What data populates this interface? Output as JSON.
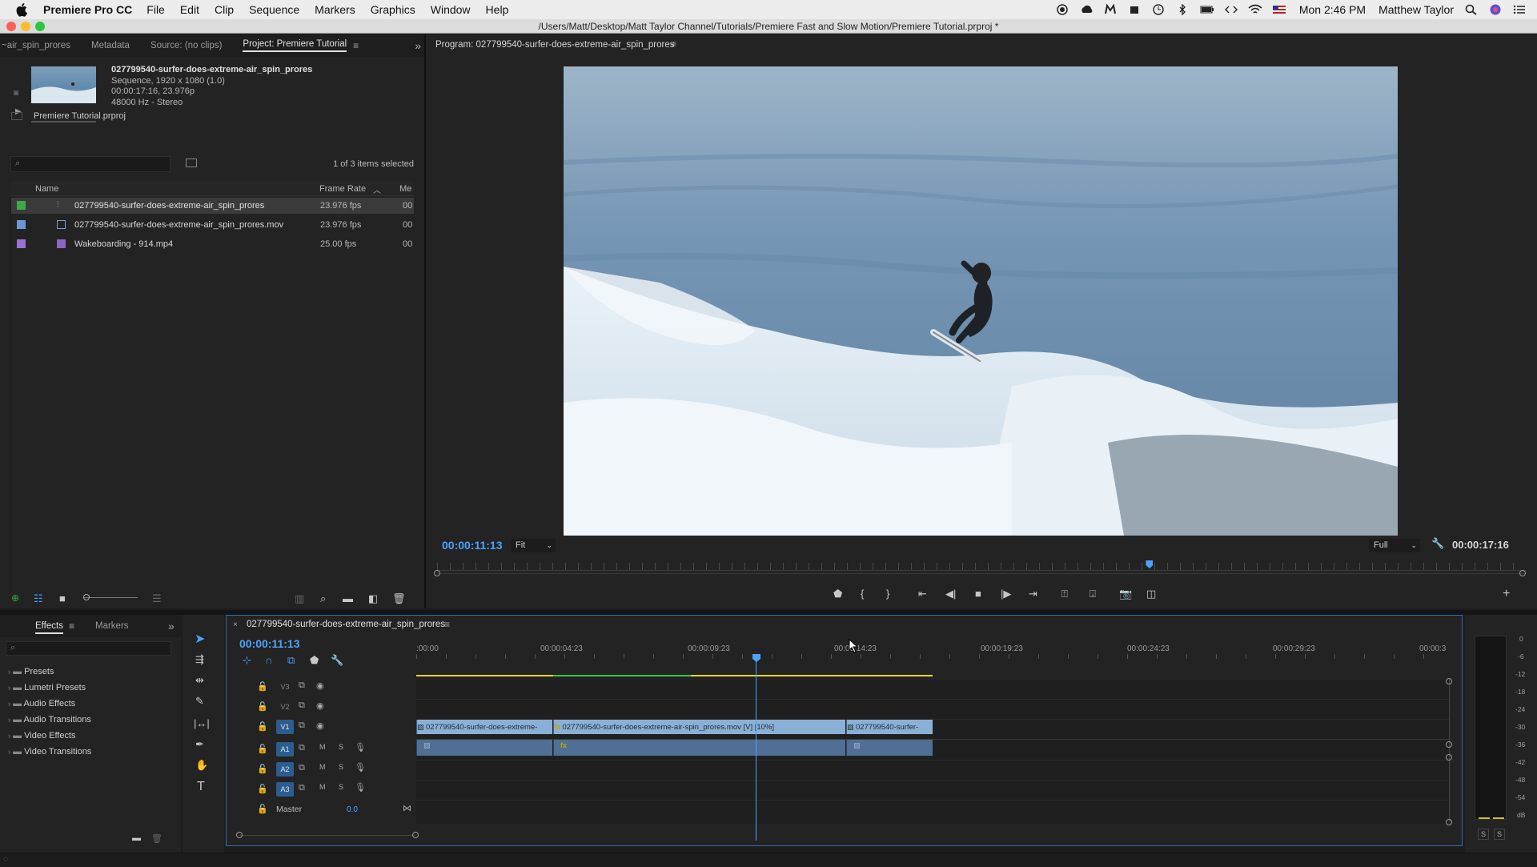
{
  "menubar": {
    "app_name": "Premiere Pro CC",
    "items": [
      "File",
      "Edit",
      "Clip",
      "Sequence",
      "Markers",
      "Graphics",
      "Window",
      "Help"
    ],
    "clock": "Mon 2:46 PM",
    "user": "Matthew Taylor"
  },
  "window": {
    "title": "/Users/Matt/Desktop/Matt Taylor Channel/Tutorials/Premiere Fast and Slow Motion/Premiere Tutorial.prproj *"
  },
  "project_panel": {
    "tabs": [
      "~air_spin_prores",
      "Metadata",
      "Source: (no clips)",
      "Project: Premiere Tutorial"
    ],
    "preview": {
      "name": "027799540-surfer-does-extreme-air_spin_prores",
      "line1": "Sequence, 1920 x 1080 (1.0)",
      "line2": "00:00:17:16, 23.976p",
      "line3": "48000 Hz - Stereo"
    },
    "project_file": "Premiere Tutorial.prproj",
    "selection_count": "1 of 3 items selected",
    "columns": {
      "name": "Name",
      "frame_rate": "Frame Rate",
      "media": "Me"
    },
    "items": [
      {
        "name": "027799540-surfer-does-extreme-air_spin_prores",
        "frame_rate": "23.976 fps",
        "media": "00",
        "color": "#3daa4a",
        "icon": "sequence-icon"
      },
      {
        "name": "027799540-surfer-does-extreme-air_spin_prores.mov",
        "frame_rate": "23.976 fps",
        "media": "00",
        "color": "#6b96d6",
        "icon": "clip-icon"
      },
      {
        "name": "Wakeboarding - 914.mp4",
        "frame_rate": "25.00 fps",
        "media": "00",
        "color": "#9b6fd6",
        "icon": "clip-icon"
      }
    ]
  },
  "program_monitor": {
    "title": "Program: 027799540-surfer-does-extreme-air_spin_prores",
    "current_timecode": "00:00:11:13",
    "fit": "Fit",
    "resolution": "Full",
    "duration": "00:00:17:16",
    "playhead_fraction": 0.654
  },
  "effects_panel": {
    "tabs": [
      "Effects",
      "Markers"
    ],
    "folders": [
      "Presets",
      "Lumetri Presets",
      "Audio Effects",
      "Audio Transitions",
      "Video Effects",
      "Video Transitions"
    ]
  },
  "timeline": {
    "sequence_name": "027799540-surfer-does-extreme-air_spin_prores",
    "timecode": "00:00:11:13",
    "ruler": [
      ":00:00",
      "00:00:04:23",
      "00:00:09:23",
      "00:00:14:23",
      "00:00:19:23",
      "00:00:24:23",
      "00:00:29:23",
      "00:00:3"
    ],
    "video_tracks": [
      "V3",
      "V2",
      "V1"
    ],
    "audio_tracks": [
      "A1",
      "A2",
      "A3"
    ],
    "master_label": "Master",
    "master_value": "0.0",
    "clips": [
      {
        "label": "027799540-surfer-does-extreme-"
      },
      {
        "label": "027799540-surfer-does-extreme-air-spin_prores.mov [V] [10%]"
      },
      {
        "label": "027799540-surfer-"
      }
    ]
  },
  "audio_meter": {
    "scale": [
      "0",
      "-6",
      "-12",
      "-18",
      "-24",
      "-30",
      "-36",
      "-42",
      "-48",
      "-54",
      "dB"
    ],
    "solo": [
      "S",
      "S"
    ]
  }
}
